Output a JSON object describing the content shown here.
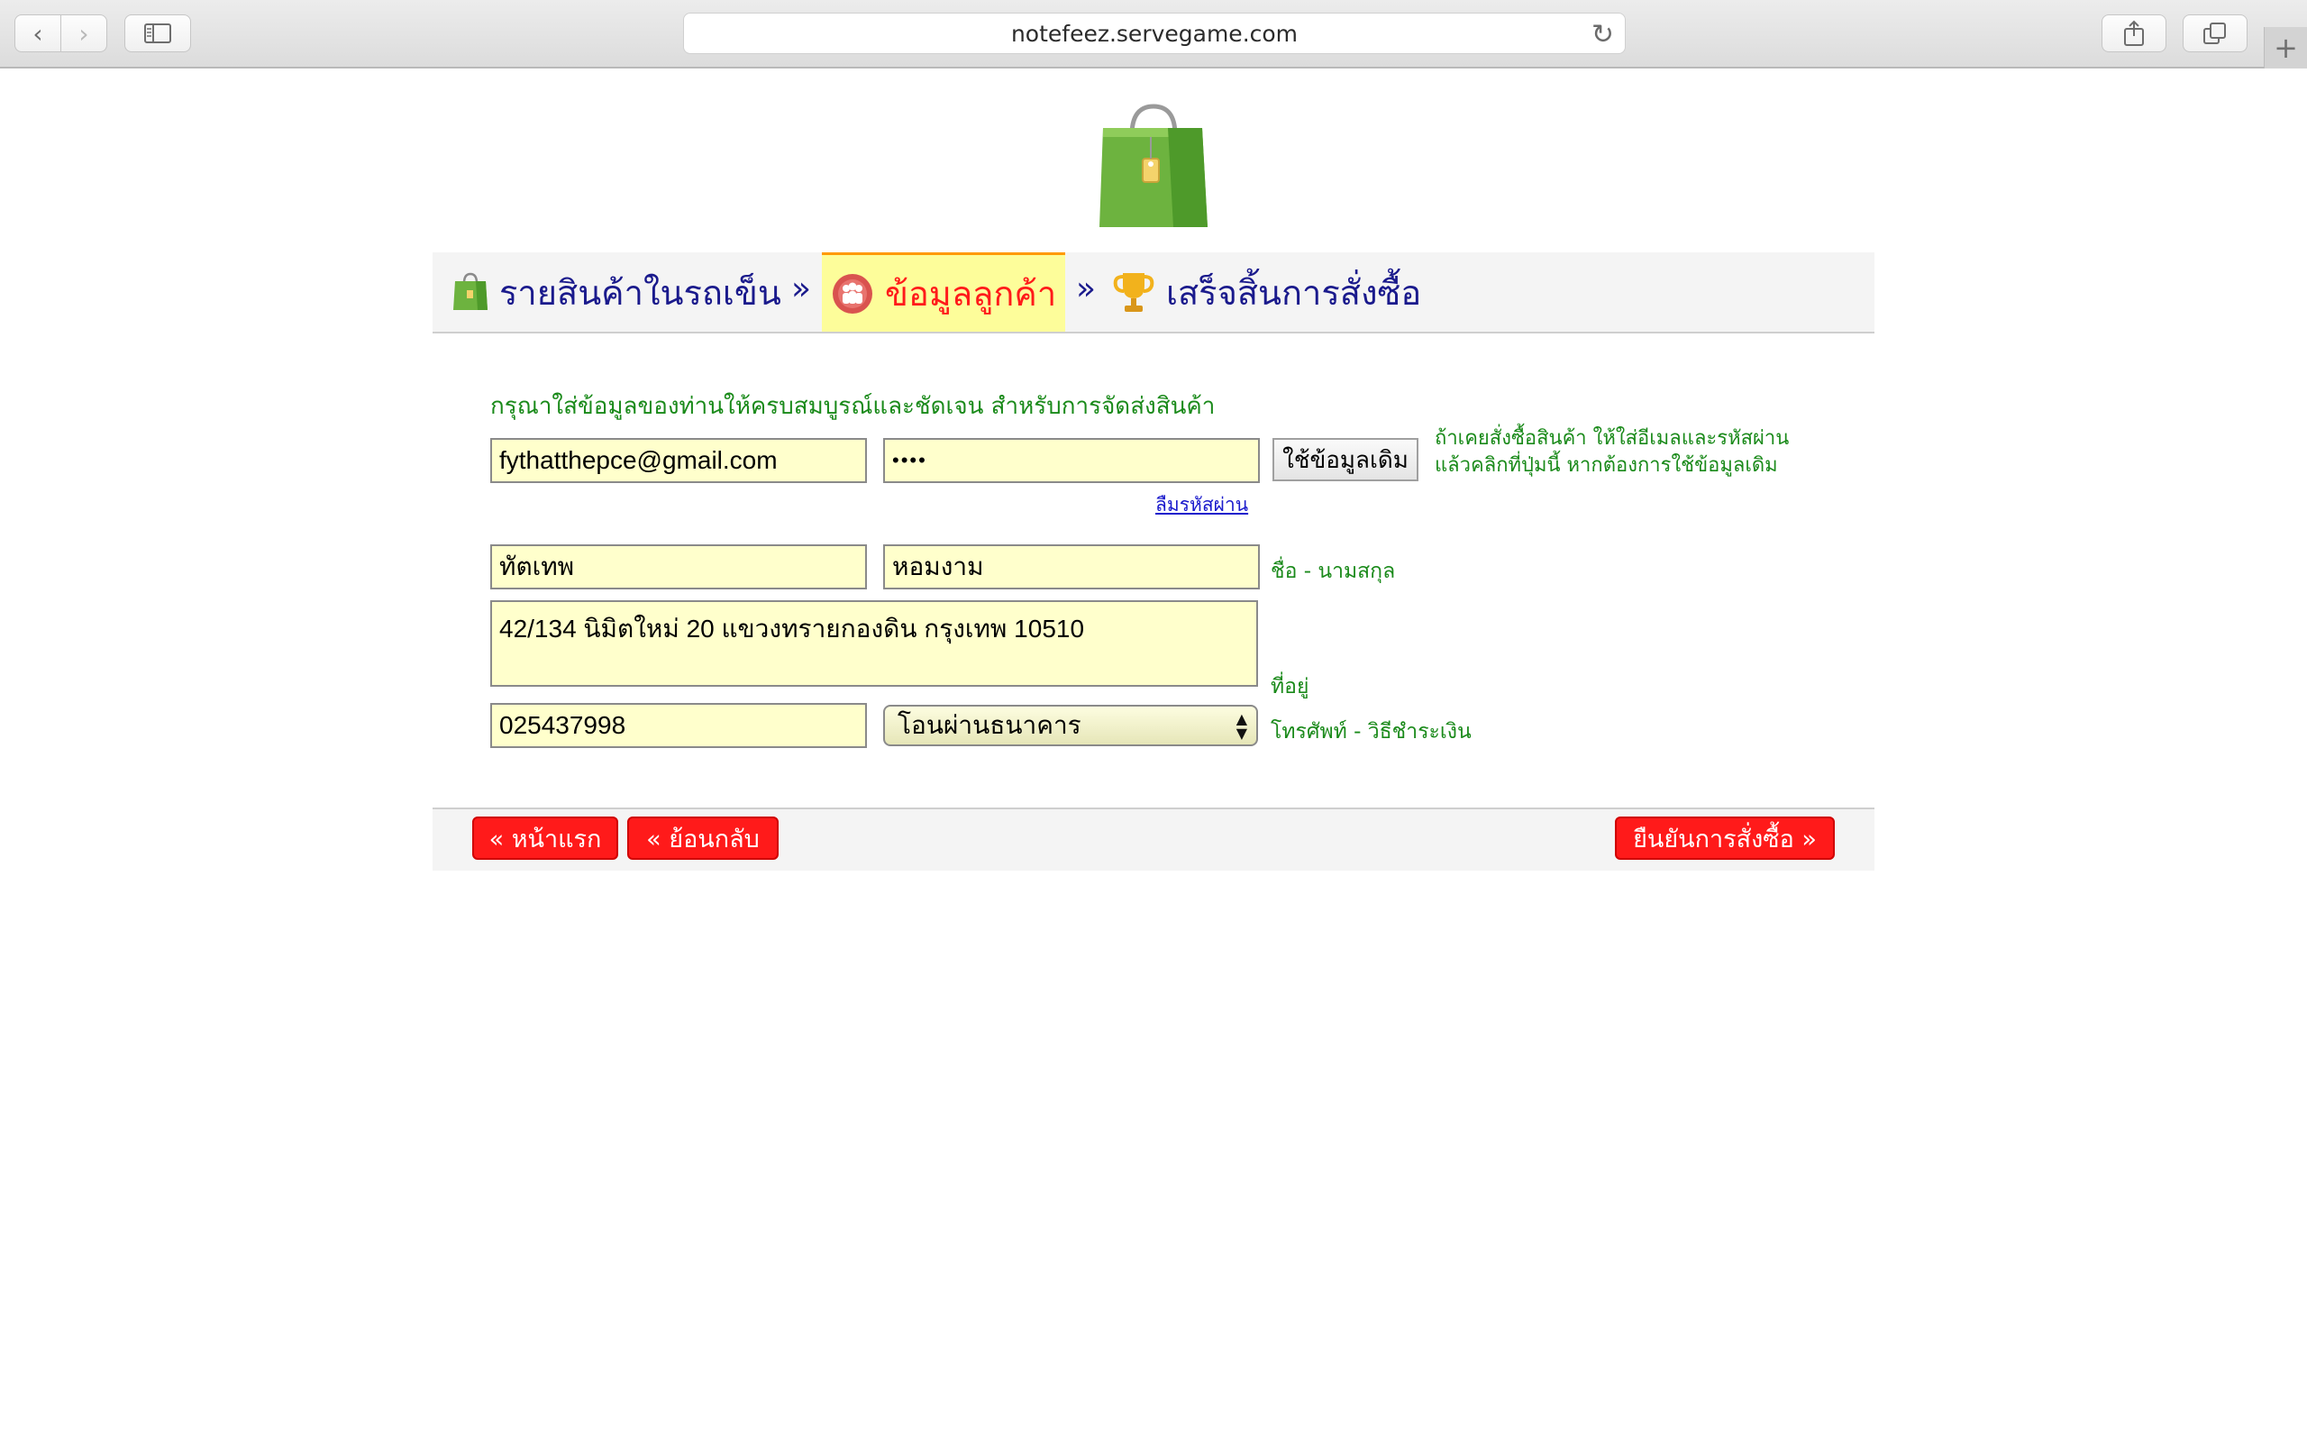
{
  "browser": {
    "url": "notefeez.servegame.com"
  },
  "steps": {
    "cart_label": "รายสินค้าในรถเข็น",
    "separator": "»",
    "customer_label": "ข้อมูลลูกค้า",
    "finish_label": "เสร็จสิ้นการสั่งซื้อ"
  },
  "form": {
    "instructions": "กรุณาใส่ข้อมูลของท่านให้ครบสมบูรณ์และชัดเจน สำหรับการจัดส่งสินค้า",
    "email_value": "fythatthepce@gmail.com",
    "password_value": "••••",
    "use_existing_label": "ใช้ข้อมูลเดิม",
    "existing_hint_line1": "ถ้าเคยสั่งซื้อสินค้า ให้ใส่อีเมลและรหัสผ่าน",
    "existing_hint_line2": "แล้วคลิกที่ปุ่มนี้ หากต้องการใช้ข้อมูลเดิม",
    "forgot_password_label": "ลืมรหัสผ่าน",
    "first_name_value": "ทัตเทพ",
    "last_name_value": "หอมงาม",
    "name_label": "ชื่อ - นามสกุล",
    "address_value": "42/134 นิมิตใหม่ 20 แขวงทรายกองดิน  กรุงเทพ 10510",
    "address_label": "ที่อยู่",
    "phone_value": "025437998",
    "payment_selected": "โอนผ่านธนาคาร",
    "phone_payment_label": "โทรศัพท์ - วิธีชำระเงิน"
  },
  "footer": {
    "home_label": "« หน้าแรก",
    "back_label": "« ย้อนกลับ",
    "confirm_label": "ยืนยันการสั่งซื้อ »"
  },
  "colors": {
    "accent_red": "#ff1a1a",
    "label_green": "#1a8a1a",
    "step_blue": "#1a1a8c",
    "field_yellow": "#ffffcc",
    "active_step_bg": "#fdfd9a"
  },
  "icons": {
    "logo": "shopping-bag-icon",
    "step_cart": "shopping-bag-icon",
    "step_customer": "people-icon",
    "step_finish": "trophy-icon"
  }
}
